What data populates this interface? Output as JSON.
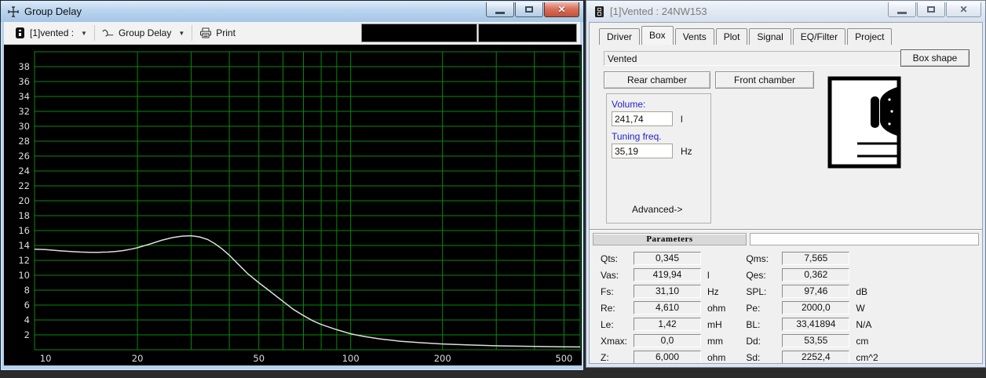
{
  "colors": {
    "chart_bg": "#000000",
    "grid_green": "#0c870c",
    "curve": "#dcdcdc",
    "tick_text": "#dddddd",
    "active_titlebar_blue": "#b3cde9",
    "label_blue": "#2222cc",
    "close_button_red": "#c2523c"
  },
  "left_window": {
    "title": "Group Delay",
    "toolbar": {
      "driver_selector_label": "[1]vented :",
      "graph_selector_label": "Group Delay",
      "print_label": "Print"
    }
  },
  "right_window": {
    "title": "[1]Vented : 24NW153",
    "tabs": [
      "Driver",
      "Box",
      "Vents",
      "Plot",
      "Signal",
      "EQ/Filter",
      "Project"
    ],
    "active_tab": "Box",
    "box_tab": {
      "box_type": "Vented",
      "box_shape_button": "Box shape",
      "rear_chamber_button": "Rear chamber",
      "front_chamber_button": "Front chamber",
      "volume_label": "Volume:",
      "volume_value": "241,74",
      "volume_unit": "l",
      "tuning_label": "Tuning freq.",
      "tuning_value": "35,19",
      "tuning_unit": "Hz",
      "advanced_label": "Advanced->"
    },
    "parameters": {
      "header": "Parameters",
      "left": [
        {
          "label": "Qts:",
          "value": "0,345",
          "unit": ""
        },
        {
          "label": "Vas:",
          "value": "419,94",
          "unit": "l"
        },
        {
          "label": "Fs:",
          "value": "31,10",
          "unit": "Hz"
        },
        {
          "label": "Re:",
          "value": "4,610",
          "unit": "ohm"
        },
        {
          "label": "Le:",
          "value": "1,42",
          "unit": "mH"
        },
        {
          "label": "Xmax:",
          "value": "0,0",
          "unit": "mm"
        },
        {
          "label": "Z:",
          "value": "6,000",
          "unit": "ohm"
        }
      ],
      "right": [
        {
          "label": "Qms:",
          "value": "7,565",
          "unit": ""
        },
        {
          "label": "Qes:",
          "value": "0,362",
          "unit": ""
        },
        {
          "label": "SPL:",
          "value": "97,46",
          "unit": "dB"
        },
        {
          "label": "Pe:",
          "value": "2000,0",
          "unit": "W"
        },
        {
          "label": "BL:",
          "value": "33,41894",
          "unit": "N/A"
        },
        {
          "label": "Dd:",
          "value": "53,55",
          "unit": "cm"
        },
        {
          "label": "Sd:",
          "value": "2252,4",
          "unit": "cm^2"
        }
      ]
    }
  },
  "chart_data": {
    "type": "line",
    "title": "Group Delay",
    "xlabel": "",
    "ylabel": "",
    "x_scale": "log",
    "xlim": [
      9.2,
      565
    ],
    "ylim": [
      0,
      40
    ],
    "x_ticks": [
      10,
      20,
      50,
      100,
      200,
      500
    ],
    "x_gridlines": [
      20,
      30,
      40,
      50,
      60,
      70,
      80,
      90,
      100,
      200,
      300,
      400,
      500
    ],
    "y_ticks": [
      2,
      4,
      6,
      8,
      10,
      12,
      14,
      16,
      18,
      20,
      22,
      24,
      26,
      28,
      30,
      32,
      34,
      36,
      38
    ],
    "grid": true,
    "legend_position": "none",
    "bg_color": "#000000",
    "grid_color": "#0c870c",
    "line_color": "#dcdcdc",
    "tick_color": "#dddddd",
    "series": [
      {
        "name": "[1]vented : Group Delay (ms)",
        "x": [
          9.2,
          10,
          11,
          12,
          13,
          14,
          15,
          16,
          17,
          18,
          19,
          20,
          22,
          24,
          26,
          28,
          30,
          32,
          34,
          36,
          38,
          40,
          43,
          46,
          50,
          55,
          60,
          65,
          70,
          75,
          80,
          90,
          100,
          110,
          125,
          145,
          170,
          200,
          240,
          290,
          350,
          430,
          500,
          565
        ],
        "y": [
          13.5,
          13.45,
          13.3,
          13.2,
          13.12,
          13.08,
          13.08,
          13.12,
          13.2,
          13.32,
          13.5,
          13.7,
          14.2,
          14.7,
          15.05,
          15.25,
          15.3,
          15.15,
          14.8,
          14.2,
          13.5,
          12.7,
          11.4,
          10.2,
          9.0,
          7.7,
          6.5,
          5.4,
          4.6,
          3.9,
          3.4,
          2.7,
          2.15,
          1.8,
          1.45,
          1.15,
          0.95,
          0.78,
          0.65,
          0.55,
          0.48,
          0.43,
          0.4,
          0.38
        ]
      }
    ]
  }
}
